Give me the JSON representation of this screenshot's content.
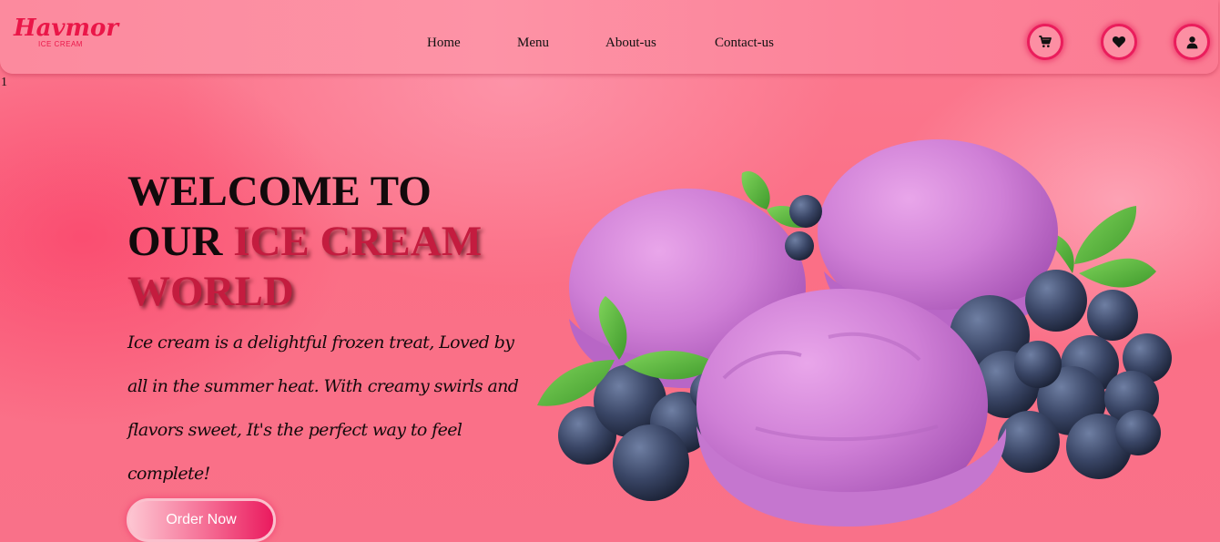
{
  "brand": {
    "name": "Havmor",
    "tagline": "ICE CREAM",
    "color": "#ea1648"
  },
  "nav": {
    "links": [
      "Home",
      "Menu",
      "About-us",
      "Contact-us"
    ],
    "icons": [
      "cart-icon",
      "heart-icon",
      "user-icon"
    ]
  },
  "stray_text": "1",
  "hero": {
    "title_plain": "WELCOME TO OUR ",
    "title_accent": "ICE CREAM WORLD",
    "description": "Ice cream is a delightful frozen treat, Loved by all in the summer heat. With creamy swirls and flavors sweet, It's the perfect way to feel complete!",
    "cta_label": "Order Now",
    "accent_color": "#c41c3f",
    "image_subject": "purple ice cream scoops with blueberries and mint leaves"
  }
}
